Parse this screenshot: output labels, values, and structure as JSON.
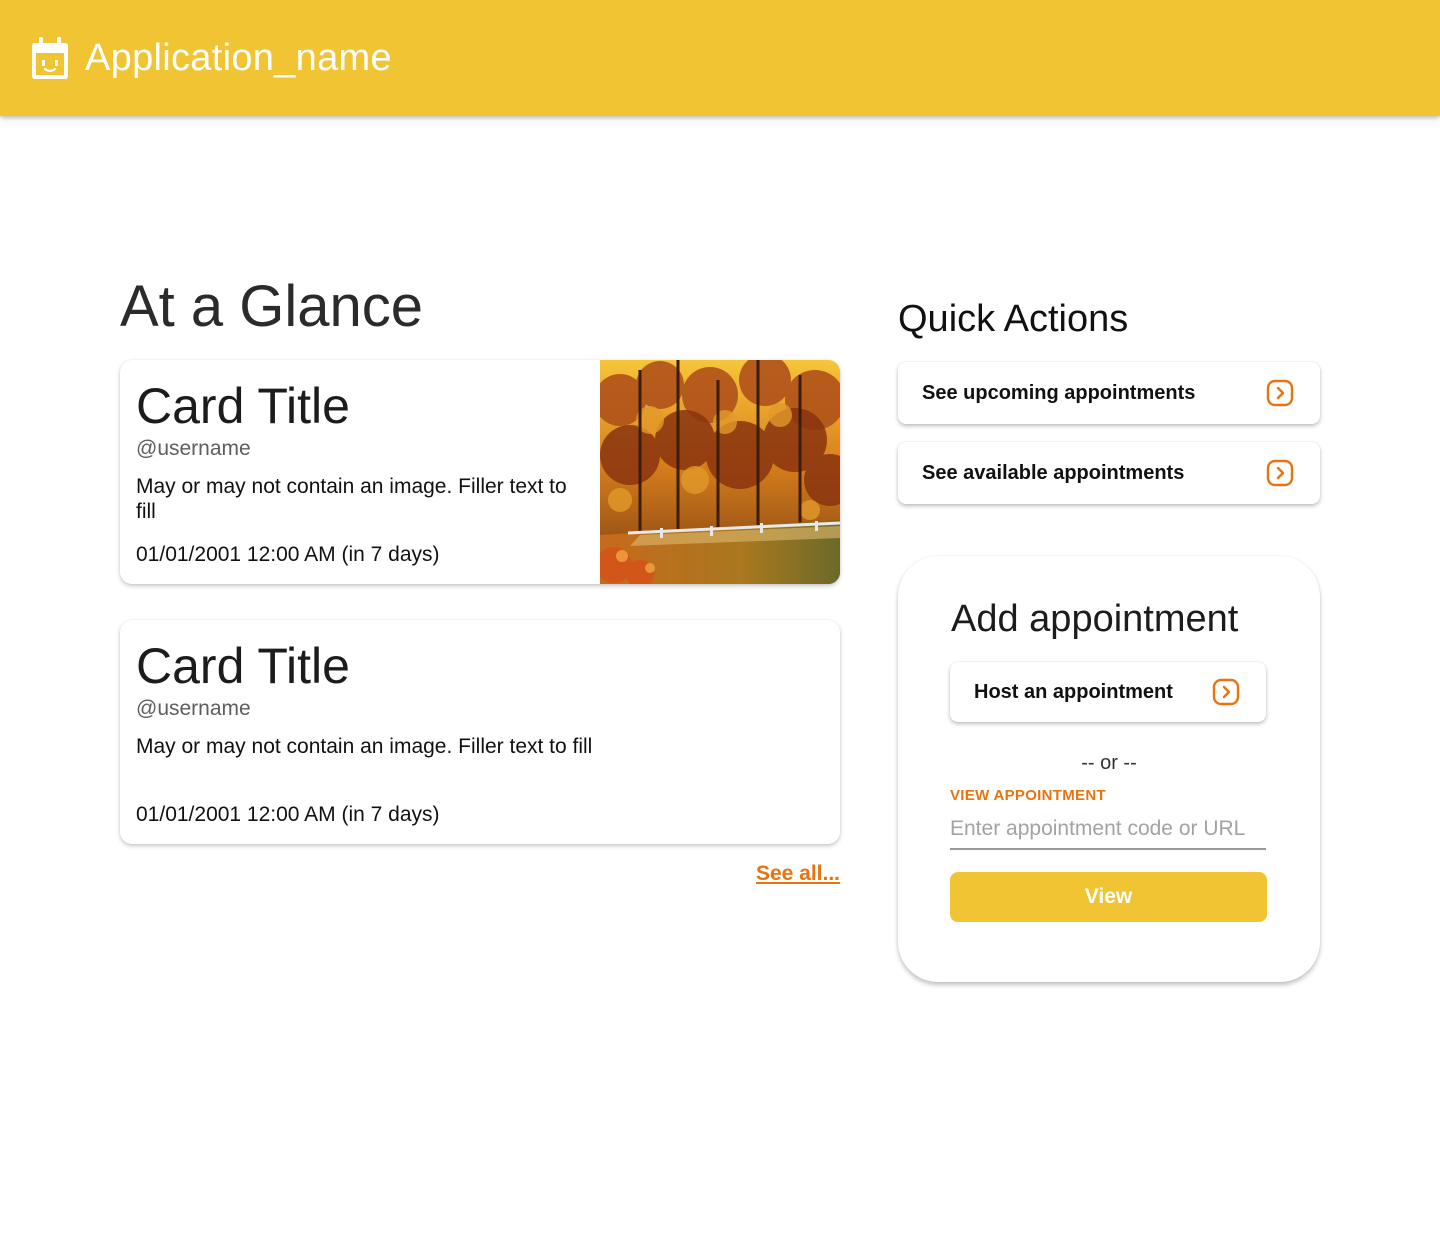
{
  "colors": {
    "primary": "#f1c433",
    "accent": "#e8730f"
  },
  "appbar": {
    "title": "Application_name",
    "icon": "calendar-face-icon"
  },
  "at_a_glance": {
    "heading": "At a Glance",
    "cards": [
      {
        "title": "Card Title",
        "username": "@username",
        "body": "May or may not contain an image. Filler text to fill",
        "date": "01/01/2001 12:00 AM (in 7 days)",
        "image": "autumn-forest-painting"
      },
      {
        "title": "Card Title",
        "username": "@username",
        "body": "May or may not contain an image. Filler text to fill",
        "date": "01/01/2001 12:00 AM (in 7 days)"
      }
    ],
    "see_all": "See all..."
  },
  "quick_actions": {
    "heading": "Quick Actions",
    "items": [
      {
        "label": "See upcoming appointments",
        "icon": "chevron-right-icon"
      },
      {
        "label": "See available appointments",
        "icon": "chevron-right-icon"
      }
    ]
  },
  "add_appointment": {
    "title": "Add appointment",
    "host_label": "Host an appointment",
    "or_text": "-- or --",
    "field_label": "VIEW APPOINTMENT",
    "input_placeholder": "Enter appointment code or URL",
    "input_value": "",
    "view_label": "View"
  }
}
